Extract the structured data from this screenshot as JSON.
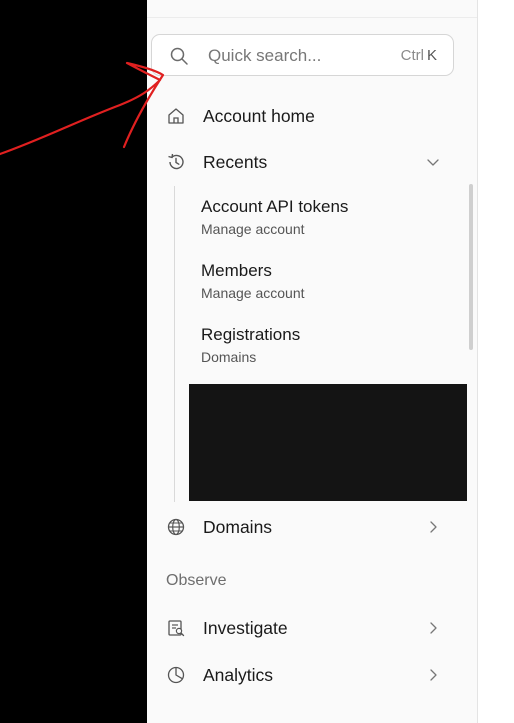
{
  "search": {
    "placeholder": "Quick search...",
    "shortcut_modifier": "Ctrl",
    "shortcut_key": "K"
  },
  "nav": {
    "account_home": "Account home",
    "recents": "Recents",
    "domains": "Domains",
    "observe_section": "Observe",
    "investigate": "Investigate",
    "analytics": "Analytics"
  },
  "recents": [
    {
      "title": "Account API tokens",
      "subtitle": "Manage account"
    },
    {
      "title": "Members",
      "subtitle": "Manage account"
    },
    {
      "title": "Registrations",
      "subtitle": "Domains"
    }
  ],
  "icons": {
    "search": "search-icon",
    "home": "home-icon",
    "history": "history-icon",
    "globe": "globe-icon",
    "investigate": "investigate-icon",
    "analytics": "pie-chart-icon",
    "chevron_down": "chevron-down-icon",
    "chevron_right": "chevron-right-icon"
  },
  "colors": {
    "sidebar_bg": "#fafafa",
    "annotation_stroke": "#e02020",
    "redaction": "#141414"
  }
}
